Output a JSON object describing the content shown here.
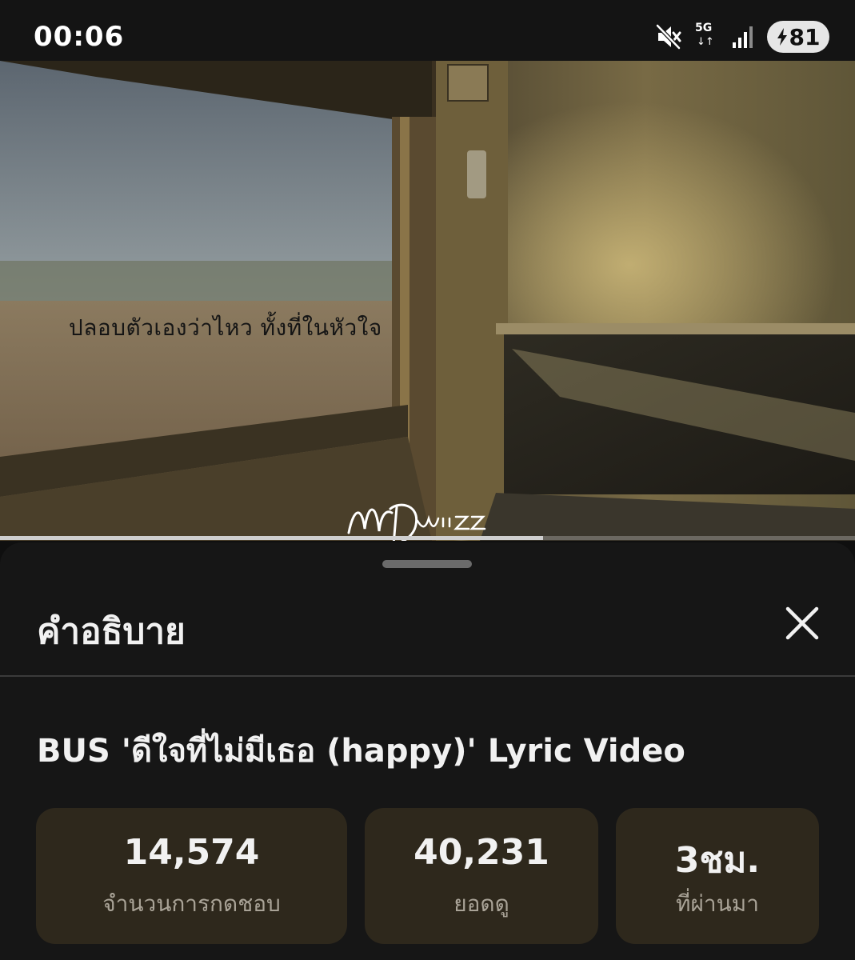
{
  "status_bar": {
    "time": "00:06",
    "network_label": "5G",
    "battery_level": "81",
    "icons": [
      "mute-icon",
      "network-5g-icon",
      "signal-icon",
      "battery-charging-icon"
    ]
  },
  "video": {
    "lyric_line": "ปลอบตัวเองว่าไหว ทั้งที่ในหัวใจ",
    "watermark_text": "MDwiizz",
    "progress": 0.635
  },
  "sheet": {
    "title": "คำอธิบาย",
    "close_icon": "close-icon",
    "video_title": "BUS 'ดีใจที่ไม่มีเธอ (happy)' Lyric Video",
    "stats": [
      {
        "value": "14,574",
        "label": "จำนวนการกดชอบ"
      },
      {
        "value": "40,231",
        "label": "ยอดดู"
      },
      {
        "value": "3ชม.",
        "label": "ที่ผ่านมา"
      }
    ]
  },
  "colors": {
    "background": "#0f0f0f",
    "sheet": "#161616",
    "stat_card": "#2e281c",
    "stat_label": "#a9a397"
  }
}
